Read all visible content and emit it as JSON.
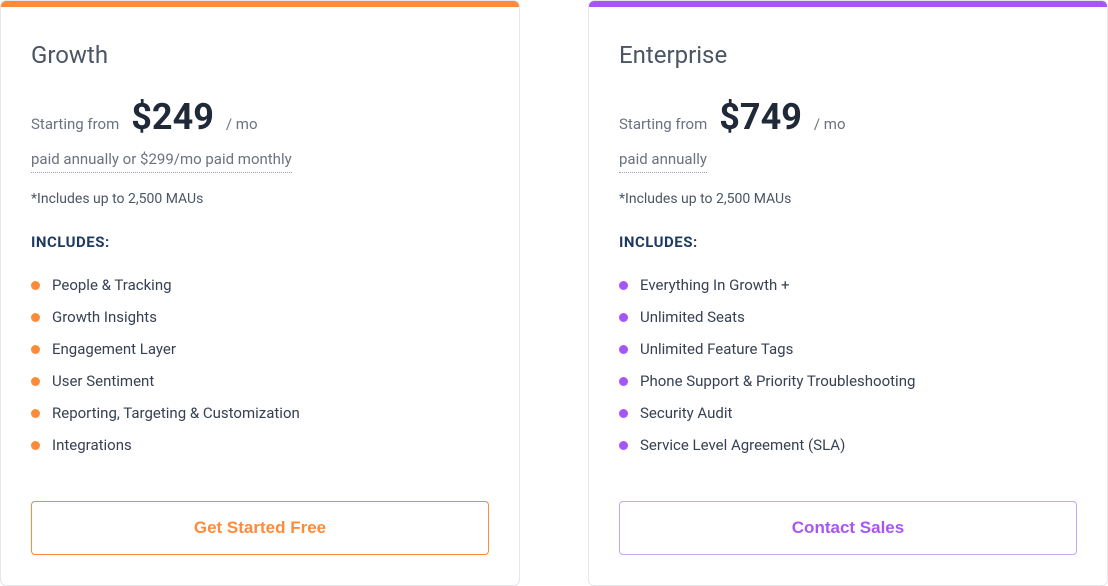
{
  "plans": [
    {
      "title": "Growth",
      "accent": "orange",
      "price_prefix": "Starting from",
      "price_amount": "$249",
      "price_suffix": "/ mo",
      "billing_note": "paid annually or $299/mo paid monthly",
      "maus_note": "*Includes up to 2,500 MAUs",
      "includes_heading": "INCLUDES:",
      "features": [
        "People & Tracking",
        "Growth Insights",
        "Engagement Layer",
        "User Sentiment",
        "Reporting, Targeting & Customization",
        "Integrations"
      ],
      "cta_label": "Get Started Free"
    },
    {
      "title": "Enterprise",
      "accent": "purple",
      "price_prefix": "Starting from",
      "price_amount": "$749",
      "price_suffix": "/ mo",
      "billing_note": "paid annually",
      "maus_note": "*Includes up to 2,500 MAUs",
      "includes_heading": "INCLUDES:",
      "features": [
        "Everything In Growth +",
        "Unlimited Seats",
        "Unlimited Feature Tags",
        "Phone Support & Priority Troubleshooting",
        "Security Audit",
        "Service Level Agreement (SLA)"
      ],
      "cta_label": "Contact Sales"
    }
  ]
}
